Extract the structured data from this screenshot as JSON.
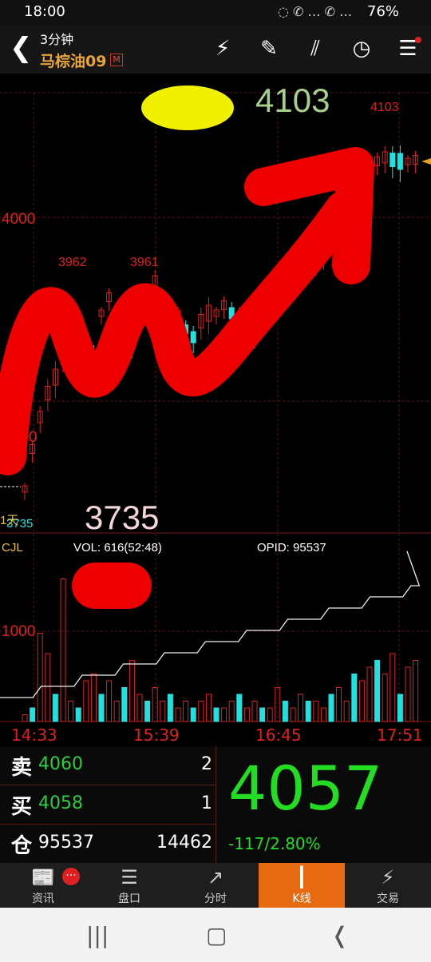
{
  "status_bar": {
    "time": "18:00",
    "signal_icons": "◌ ✆ … ✆ …",
    "battery": "76%"
  },
  "header": {
    "back_icon": "❮",
    "interval": "3分钟",
    "symbol": "马棕油09",
    "badge": "M"
  },
  "toolbar": {
    "icons": [
      "lightning-icon",
      "pencil-icon",
      "trend-lines-icon",
      "clock-icon",
      "menu-icon"
    ]
  },
  "chart_data": {
    "type": "candlestick",
    "y_axis_labels": [
      "4000"
    ],
    "price_annotations": {
      "high": "4103",
      "high_big": "4103",
      "mid_high_1": "3962",
      "mid_high_2": "3961",
      "low": "3735",
      "low_big": "3735"
    },
    "partial_labels": {
      "left_marker": "1天",
      "left_tick": "0"
    },
    "x_labels": [
      "14:33",
      "15:39",
      "16:45",
      "17:51"
    ],
    "volume_panel": {
      "indicator": "CJL",
      "vol": "VOL: 616(52:48)",
      "opid": "OPID: 95537",
      "y_label": "1000"
    }
  },
  "order_book": {
    "sell": {
      "label": "卖",
      "price": "4060",
      "qty": "2"
    },
    "buy": {
      "label": "买",
      "price": "4058",
      "qty": "1"
    },
    "position": {
      "label": "仓",
      "value": "95537",
      "change": "14462"
    }
  },
  "quote": {
    "price": "4057",
    "change": "-117/2.80%"
  },
  "tabs": [
    {
      "label": "资讯",
      "icon": "📰"
    },
    {
      "label": "盘口",
      "icon": "☰"
    },
    {
      "label": "分时",
      "icon": "↗"
    },
    {
      "label": "K线",
      "icon": "┃"
    },
    {
      "label": "交易",
      "icon": "⚡"
    }
  ],
  "nav_icons": [
    "recents-icon",
    "home-icon",
    "back-icon"
  ],
  "nav_glyphs": [
    "|||",
    "▢",
    "❬"
  ],
  "colors": {
    "up": "#e02020",
    "down": "#20e0e0",
    "accent": "#e86a10",
    "green": "#22dd22"
  }
}
